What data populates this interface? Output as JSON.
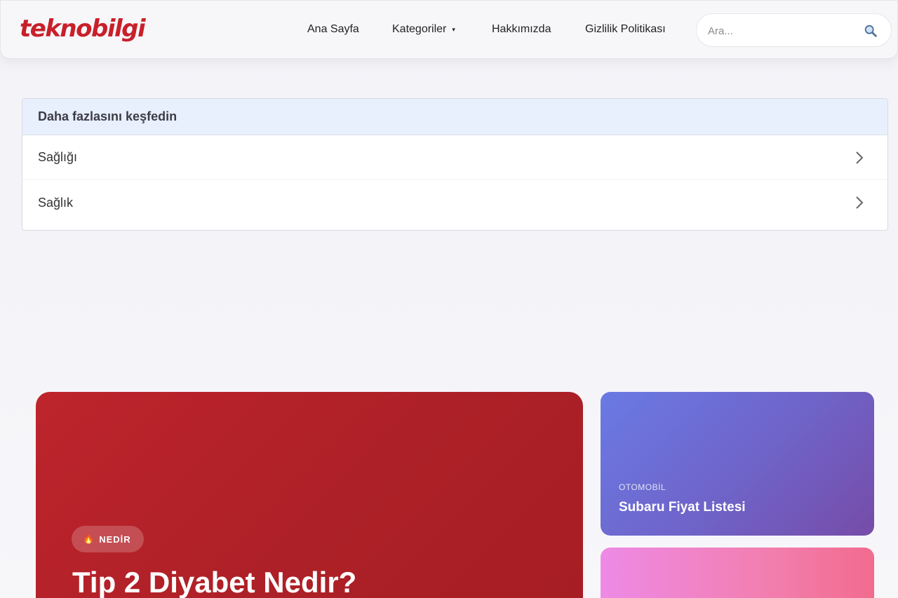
{
  "header": {
    "logo": "teknobilgi",
    "nav": [
      {
        "label": "Ana Sayfa"
      },
      {
        "label": "Kategoriler",
        "caret": "▾"
      },
      {
        "label": "Hakkımızda"
      },
      {
        "label": "Gizlilik Politikası"
      }
    ],
    "search": {
      "placeholder": "Ara...",
      "value": ""
    }
  },
  "explore": {
    "title": "Daha fazlasını keşfedin",
    "items": [
      {
        "label": "Sağlığı",
        "icon": "chevron-right-icon"
      },
      {
        "label": "Sağlık",
        "icon": "chevron-right-icon"
      }
    ]
  },
  "featured": {
    "badge_icon": "🔥",
    "badge": "NEDİR",
    "title": "Tip 2 Diyabet Nedir?"
  },
  "side_cards": [
    {
      "category": "OTOMOBİL",
      "title": "Subaru Fiyat Listesi"
    }
  ],
  "colors": {
    "brand": "#c8202a",
    "featured_bg": "#b02128",
    "card_a_bg": "#6f63c8",
    "card_b_bg": "#f27fb0",
    "explore_header_bg": "#e8effd"
  }
}
